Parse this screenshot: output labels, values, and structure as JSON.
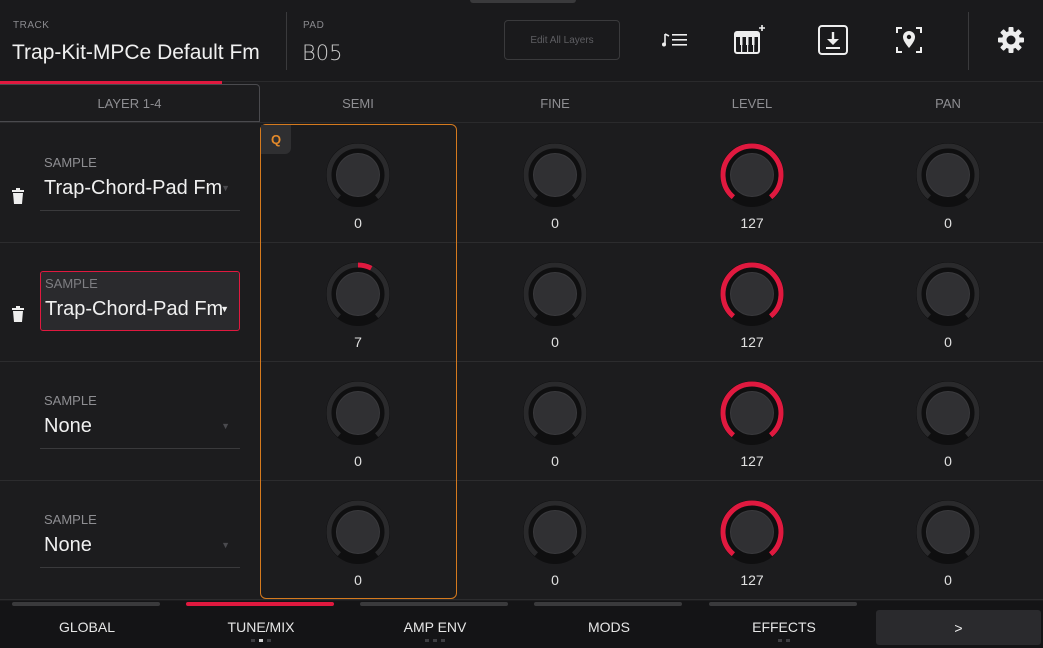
{
  "header": {
    "track_label": "TRACK",
    "track_name": "Trap-Kit-MPCe Default Fm",
    "pad_label": "PAD",
    "pad_name": "B05",
    "edit_all_label": "Edit All Layers",
    "icons": [
      "note-list-icon",
      "keyboard-plus-icon",
      "download-icon",
      "location-target-icon",
      "settings-gear-icon"
    ]
  },
  "columns": {
    "layer_tab": "LAYER 1-4",
    "semi": "SEMI",
    "fine": "FINE",
    "level": "LEVEL",
    "pan": "PAN"
  },
  "q_badge": "Q",
  "layers": [
    {
      "sample_label": "SAMPLE",
      "sample": "Trap-Chord-Pad Fm",
      "has_trash": true,
      "selected": false,
      "semi": "0",
      "fine": "0",
      "level": "127",
      "pan": "0"
    },
    {
      "sample_label": "SAMPLE",
      "sample": "Trap-Chord-Pad Fm",
      "has_trash": true,
      "selected": true,
      "semi": "7",
      "fine": "0",
      "level": "127",
      "pan": "0"
    },
    {
      "sample_label": "SAMPLE",
      "sample": "None",
      "has_trash": false,
      "selected": false,
      "semi": "0",
      "fine": "0",
      "level": "127",
      "pan": "0"
    },
    {
      "sample_label": "SAMPLE",
      "sample": "None",
      "has_trash": false,
      "selected": false,
      "semi": "0",
      "fine": "0",
      "level": "127",
      "pan": "0"
    }
  ],
  "dropdown_arrow": "▼",
  "bottom_tabs": [
    {
      "label": "GLOBAL",
      "active": false
    },
    {
      "label": "TUNE/MIX",
      "active": true
    },
    {
      "label": "AMP ENV",
      "active": false
    },
    {
      "label": "MODS",
      "active": false
    },
    {
      "label": "EFFECTS",
      "active": false
    }
  ],
  "next_label": ">",
  "colors": {
    "accent": "#e0193f",
    "quantize": "#d57a1e",
    "background": "#1c1c1e"
  }
}
